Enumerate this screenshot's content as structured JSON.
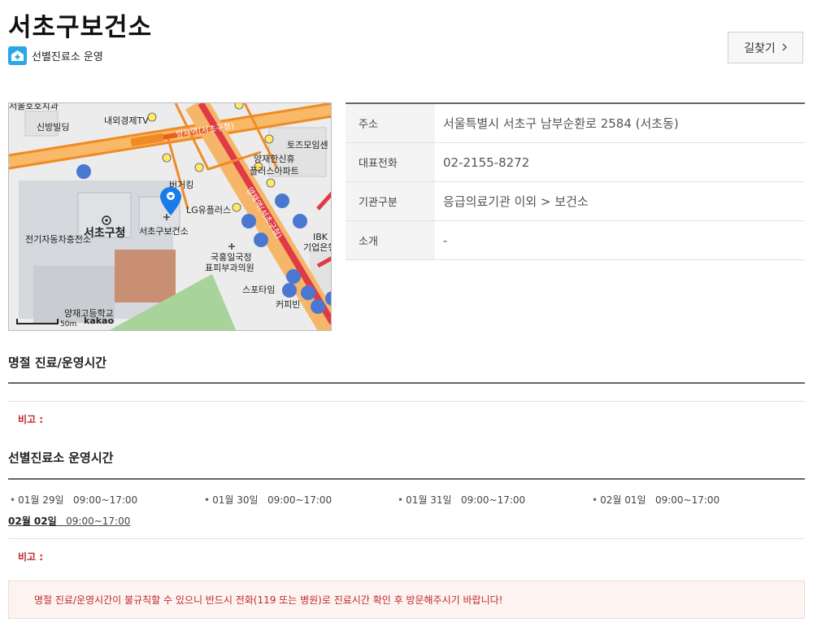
{
  "facility": {
    "name": "서초구보건소",
    "badge": "선별진료소 운영",
    "directions_label": "길찾기"
  },
  "info_rows": [
    {
      "label": "주소",
      "value": "서울특별시 서초구 남부순환로 2584 (서초동)"
    },
    {
      "label": "대표전화",
      "value": "02-2155-8272"
    },
    {
      "label": "기관구분",
      "value": "응급의료기관 이외 > 보건소"
    },
    {
      "label": "소개",
      "value": "-"
    }
  ],
  "map": {
    "labels": {
      "top_left": "서울호호치과",
      "sinbang": "신방빌딩",
      "naeoe": "내외경제TV",
      "station": "양재역(서초구청)",
      "tojeu": "토즈모임센",
      "yangjae_apt1": "양재한신휴",
      "yangjae_apt2": "플러스아파트",
      "burger": "버거킹",
      "lg": "LG유플러스",
      "ev": "전기자동차충전소",
      "gu_office": "서초구청",
      "health": "서초구보건소",
      "road": "양재역(서초구청)",
      "ibk1": "IBK",
      "ibk2": "기업은행",
      "derm1": "국홍일국정",
      "derm2": "표피부과의원",
      "sports": "스포타임",
      "coffee": "커피빈",
      "school": "양재고등학교",
      "scale": "50m",
      "logo": "kakao"
    }
  },
  "holiday_section": {
    "title": "명절 진료/운영시간",
    "note_label": "비고 :"
  },
  "screening_section": {
    "title": "선별진료소 운영시간",
    "schedule": [
      {
        "date": "01월 29일",
        "time": "09:00~17:00"
      },
      {
        "date": "01월 30일",
        "time": "09:00~17:00"
      },
      {
        "date": "01월 31일",
        "time": "09:00~17:00"
      },
      {
        "date": "02월 01일",
        "time": "09:00~17:00"
      },
      {
        "date": "02월 02일",
        "time": "09:00~17:00"
      }
    ],
    "note_label": "비고 :"
  },
  "alert": "명절 진료/운영시간이 불규칙할 수 있으니 반드시 전화(119 또는 병원)로 진료시간 확인 후 방문해주시기 바랍니다!",
  "colors": {
    "badge_blue": "#2aa7e6",
    "note_red": "#c1272d",
    "road_red": "#e03a45",
    "road_orange": "#f08a24"
  }
}
